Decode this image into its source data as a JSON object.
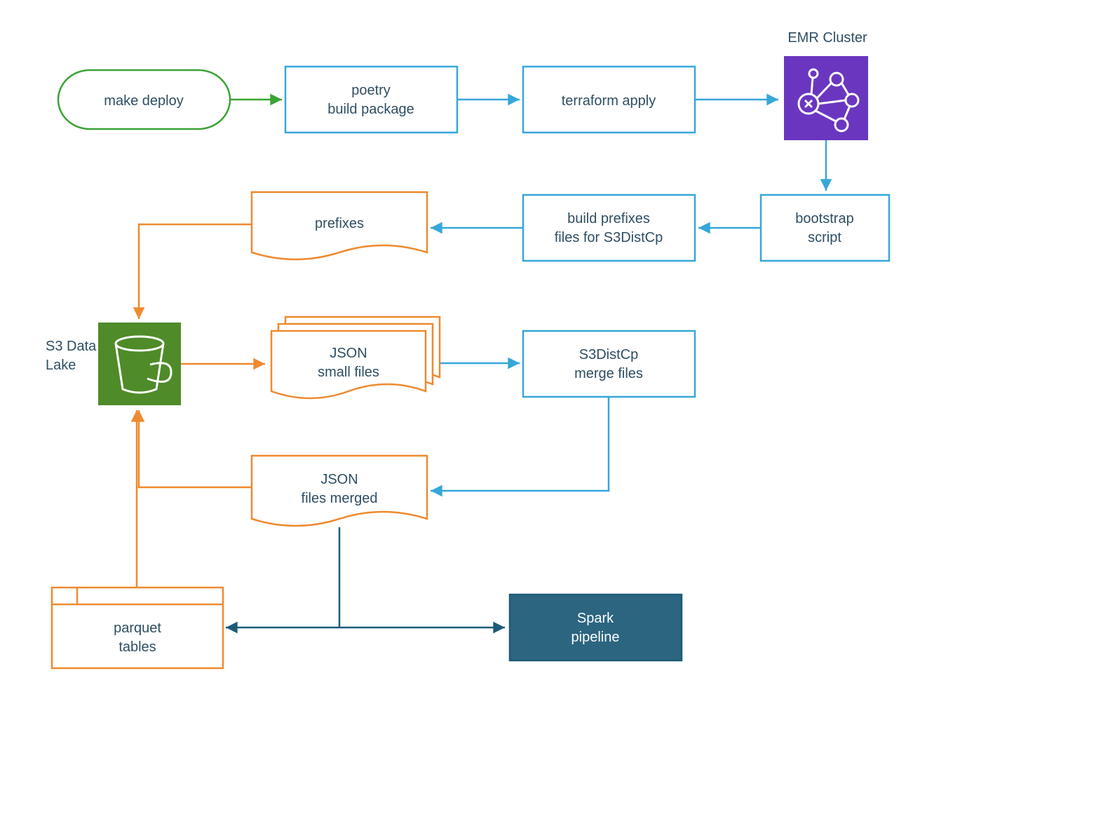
{
  "diagram": {
    "emr_title": "EMR Cluster",
    "make_deploy": "make deploy",
    "poetry_l1": "poetry",
    "poetry_l2": "build package",
    "terraform": "terraform apply",
    "bootstrap_l1": "bootstrap",
    "bootstrap_l2": "script",
    "build_prefixes_l1": "build prefixes",
    "build_prefixes_l2": "files for S3DistCp",
    "prefixes": "prefixes",
    "s3_label_l1": "S3 Data",
    "s3_label_l2": "Lake",
    "json_small_l1": "JSON",
    "json_small_l2": "small files",
    "s3distcp_l1": "S3DistCp",
    "s3distcp_l2": "merge files",
    "json_merged_l1": "JSON",
    "json_merged_l2": "files merged",
    "spark_l1": "Spark",
    "spark_l2": "pipeline",
    "parquet_l1": "parquet",
    "parquet_l2": "tables"
  },
  "colors": {
    "green": "#3aa335",
    "blue": "#36a7d9",
    "orange": "#ee8a2f",
    "darkblue": "#1b5b78",
    "purple": "#6a36c0",
    "s3green": "#4f8b28",
    "text": "#2e4e63"
  }
}
